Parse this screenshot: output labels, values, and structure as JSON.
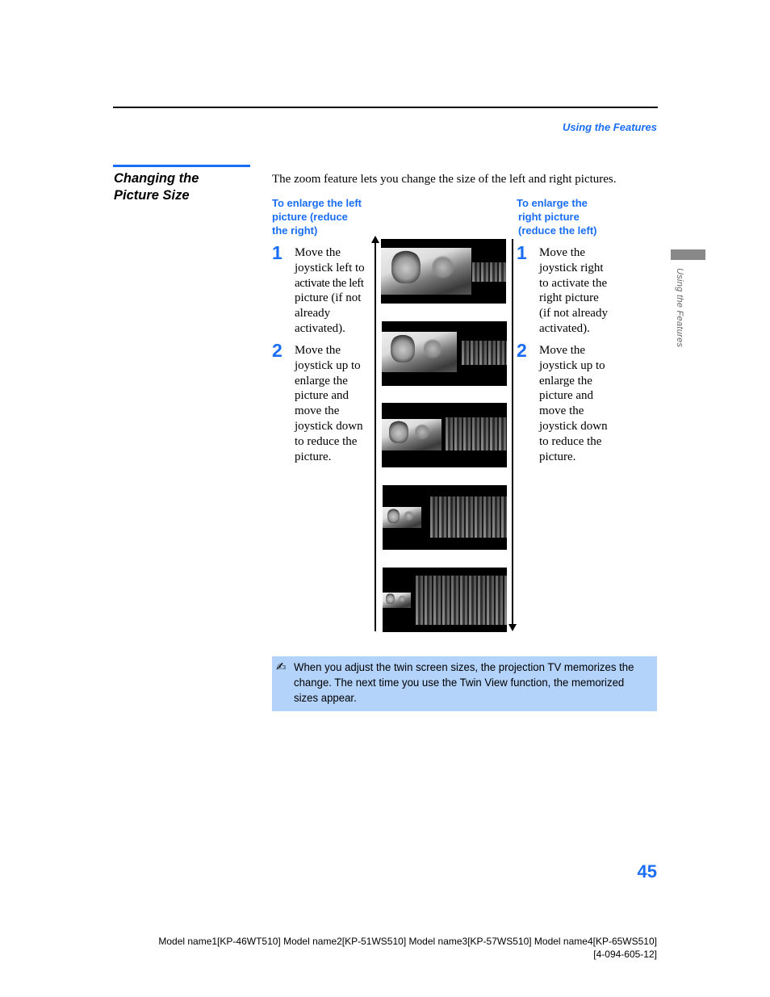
{
  "header": {
    "running_head": "Using the Features"
  },
  "section": {
    "title_line1": "Changing the",
    "title_line2": "Picture Size",
    "intro": "The zoom feature lets you change the size of the left and right pictures."
  },
  "left_column": {
    "heading": [
      "To enlarge the left",
      "picture (reduce",
      "the right)"
    ],
    "steps": [
      {
        "number": "1",
        "lines": [
          "Move the",
          "joystick left to",
          "activate the left",
          "picture (if not",
          "already",
          "activated)."
        ]
      },
      {
        "number": "2",
        "lines": [
          "Move the",
          "joystick up to",
          "enlarge the",
          "picture and",
          "move the",
          "joystick down",
          "to reduce the",
          "picture."
        ]
      }
    ]
  },
  "right_column": {
    "heading": [
      "To enlarge the",
      "right picture",
      "(reduce the left)"
    ],
    "steps": [
      {
        "number": "1",
        "lines": [
          "Move the",
          "joystick right",
          "to activate the",
          "right picture",
          "(if not already",
          "activated)."
        ]
      },
      {
        "number": "2",
        "lines": [
          "Move the",
          "joystick up to",
          "enlarge the",
          "picture and",
          "move the",
          "joystick down",
          "to reduce the",
          "picture."
        ]
      }
    ]
  },
  "illustration": {
    "description": "Twin View screens showing left picture (faces) and right picture (baseball team) at 5 size ratios",
    "frames": [
      {
        "left_picture": "faces",
        "right_picture": "team",
        "state": "left largest"
      },
      {
        "left_picture": "faces",
        "right_picture": "team",
        "state": "left larger"
      },
      {
        "left_picture": "faces",
        "right_picture": "team",
        "state": "equal"
      },
      {
        "left_picture": "faces",
        "right_picture": "team",
        "state": "right larger"
      },
      {
        "left_picture": "faces",
        "right_picture": "team",
        "state": "right largest"
      }
    ],
    "left_arrow": "up-arrow",
    "right_arrow": "down-arrow"
  },
  "note": {
    "icon": "pencil-note-icon",
    "icon_glyph": "✍",
    "lines": [
      "When you adjust the twin screen sizes, the projection TV memorizes the",
      "change. The next time you use the Twin View function, the memorized",
      "sizes appear."
    ]
  },
  "side_tab": {
    "label": "Using the Features"
  },
  "footer": {
    "page_number": "45",
    "models": "Model name1[KP-46WT510] Model name2[KP-51WS510] Model name3[KP-57WS510] Model name4[KP-65WS510]",
    "doc_code": "[4-094-605-12]"
  },
  "colors": {
    "accent_blue": "#1a6ef5",
    "note_background": "#b3d3fb",
    "side_tab_gray": "#888888"
  }
}
